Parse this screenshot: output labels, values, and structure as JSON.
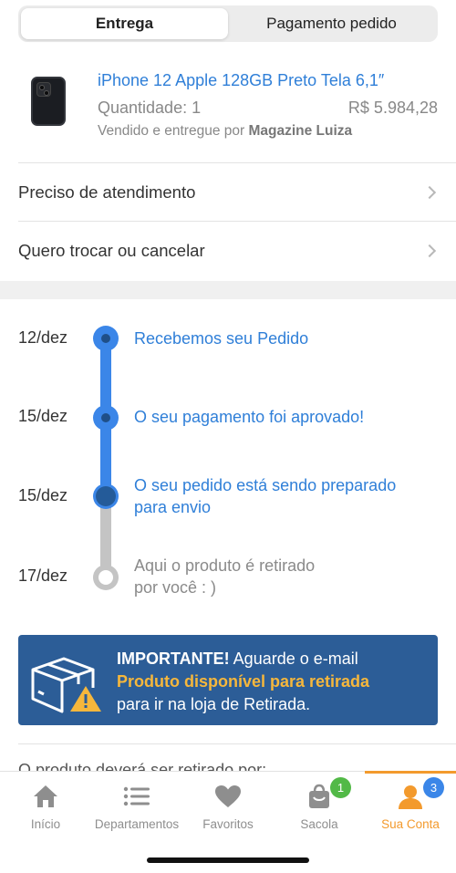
{
  "tabs": [
    {
      "label": "Entrega",
      "active": true
    },
    {
      "label": "Pagamento pedido",
      "active": false
    }
  ],
  "product": {
    "title": "iPhone 12 Apple 128GB Preto Tela 6,1″",
    "quantity": "Quantidade: 1",
    "price": "R$ 5.984,28",
    "seller_prefix": "Vendido e entregue por",
    "seller_name": "Magazine Luiza"
  },
  "menu": [
    {
      "label": "Preciso de atendimento"
    },
    {
      "label": "Quero trocar ou cancelar"
    }
  ],
  "timeline": [
    {
      "date": "12/dez",
      "text": "Recebemos seu Pedido",
      "state": "done"
    },
    {
      "date": "15/dez",
      "text": "O seu pagamento foi aprovado!",
      "state": "done"
    },
    {
      "date": "15/dez",
      "text_line1": "O seu pedido está sendo preparado",
      "text_line2": "para envio",
      "state": "current"
    },
    {
      "date": "17/dez",
      "text_line1": "Aqui o produto é retirado",
      "text_line2": "por você : )",
      "state": "pending"
    }
  ],
  "important": {
    "title": "IMPORTANTE!",
    "line1_rest": "Aguarde o e-mail",
    "highlight": "Produto disponível para retirada",
    "line3": "para ir na loja de Retirada."
  },
  "cut_text": "O produto deverá ser retirado por:",
  "nav": [
    {
      "label": "Início",
      "icon": "home-icon"
    },
    {
      "label": "Departamentos",
      "icon": "list-icon"
    },
    {
      "label": "Favoritos",
      "icon": "heart-icon"
    },
    {
      "label": "Sacola",
      "icon": "bag-icon",
      "badge": "1"
    },
    {
      "label": "Sua Conta",
      "icon": "user-icon",
      "badge": "3",
      "active": true
    }
  ],
  "colors": {
    "link_blue": "#2f7fd8",
    "timeline_blue": "#3b86e8",
    "important_bg": "#2c5d97",
    "accent_orange": "#f39a2d",
    "badge_green": "#52b947",
    "badge_blue": "#3b86e8"
  }
}
